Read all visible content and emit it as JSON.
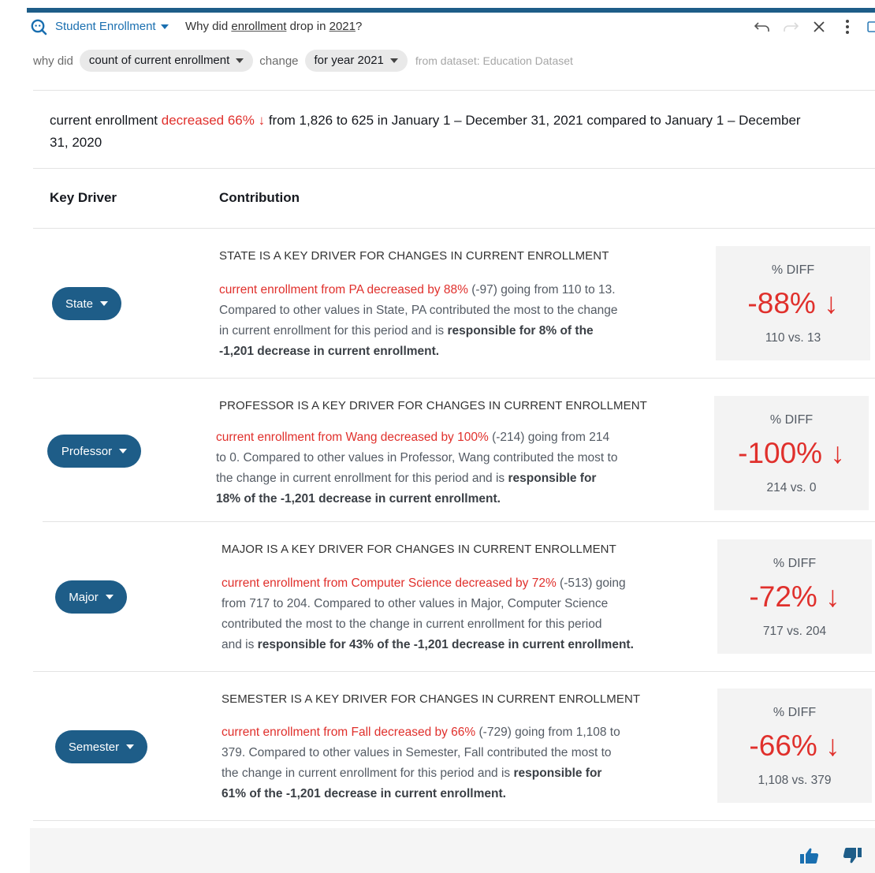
{
  "header": {
    "topic": "Student Enrollment",
    "question_prefix": "Why did ",
    "question_word1": "enrollment",
    "question_mid": " drop in ",
    "question_word2": "2021",
    "question_suffix": "?"
  },
  "query": {
    "why_did": "why did",
    "metric_pill": "count of current enrollment",
    "change": "change",
    "period_pill": "for year 2021",
    "dataset_note": "from dataset: Education Dataset"
  },
  "summary": {
    "part1": "current enrollment ",
    "change": "decreased 66% ↓",
    "part2": " from 1,826 to 625 in January 1 – December 31, 2021 compared to January 1 – December",
    "line2": "31, 2020"
  },
  "table": {
    "col_driver": "Key Driver",
    "col_contribution": "Contribution"
  },
  "drivers": [
    {
      "pill": "State",
      "title": "STATE IS A KEY DRIVER FOR CHANGES IN CURRENT ENROLLMENT",
      "red": "current enrollment from PA decreased by 88%",
      "line1": " (-97) going from 110 to 13.",
      "line2": "Compared to other values in State, PA contributed the most to the change",
      "line3a": "in current enrollment for this period and is ",
      "line3b": "responsible for 8% of the",
      "line4": "-1,201 decrease in current enrollment.",
      "diff_label": "% DIFF",
      "diff_value": "-88% ↓",
      "diff_compare": "110 vs. 13"
    },
    {
      "pill": "Professor",
      "title": "PROFESSOR IS A KEY DRIVER FOR CHANGES IN CURRENT ENROLLMENT",
      "red": "current enrollment from Wang decreased by 100%",
      "line1": " (-214) going from 214",
      "line2": "to 0. Compared to other values in Professor, Wang contributed the most to",
      "line3a": "the change in current enrollment for this period and is ",
      "line3b": "responsible for",
      "line4": "18% of the -1,201 decrease in current enrollment.",
      "diff_label": "% DIFF",
      "diff_value": "-100% ↓",
      "diff_compare": "214 vs. 0"
    },
    {
      "pill": "Major",
      "title": "MAJOR IS A KEY DRIVER FOR CHANGES IN CURRENT ENROLLMENT",
      "red": "current enrollment from Computer Science decreased by 72%",
      "line1": " (-513) going",
      "line2": "from 717 to 204. Compared to other values in Major, Computer Science",
      "line3a": "contributed the most to the change in current enrollment for this period",
      "line3b": "",
      "line4a": "and is ",
      "line4": "responsible for 43% of the -1,201 decrease in current enrollment.",
      "diff_label": "% DIFF",
      "diff_value": "-72% ↓",
      "diff_compare": "717 vs. 204"
    },
    {
      "pill": "Semester",
      "title": "SEMESTER IS A KEY DRIVER FOR CHANGES IN CURRENT ENROLLMENT",
      "red": "current enrollment from Fall decreased by 66%",
      "line1": " (-729) going from 1,108 to",
      "line2": "379. Compared to other values in Semester, Fall contributed the most to",
      "line3a": "the change in current enrollment for this period and is ",
      "line3b": "responsible for",
      "line4": "61% of the -1,201 decrease in current enrollment.",
      "diff_label": "% DIFF",
      "diff_value": "-66% ↓",
      "diff_compare": "1,108 vs. 379"
    }
  ]
}
